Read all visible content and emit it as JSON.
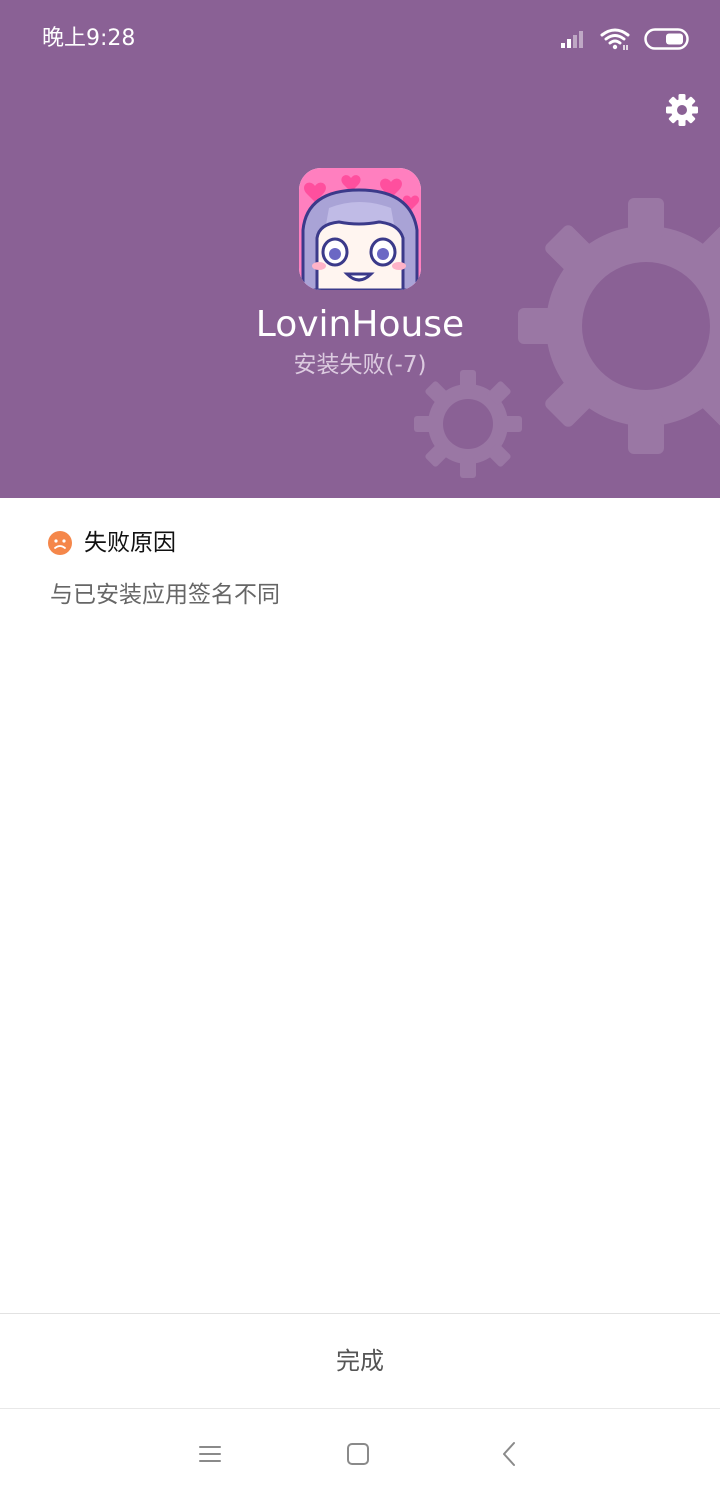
{
  "status_bar": {
    "time": "晚上9:28",
    "icons": [
      "signal-icon",
      "wifi-icon",
      "battery-icon"
    ]
  },
  "header": {
    "background_color": "#8a6195",
    "app_name": "LovinHouse",
    "install_status": "安装失败(-7)",
    "icons": [
      "settings-gear-icon",
      "app-icon"
    ]
  },
  "reason": {
    "title": "失败原因",
    "detail": "与已安装应用签名不同",
    "icon": "sad-face-icon",
    "icon_color": "#f5874a"
  },
  "footer": {
    "done_label": "完成"
  },
  "nav_bar": {
    "buttons": [
      "menu-icon",
      "home-icon",
      "back-icon"
    ]
  }
}
